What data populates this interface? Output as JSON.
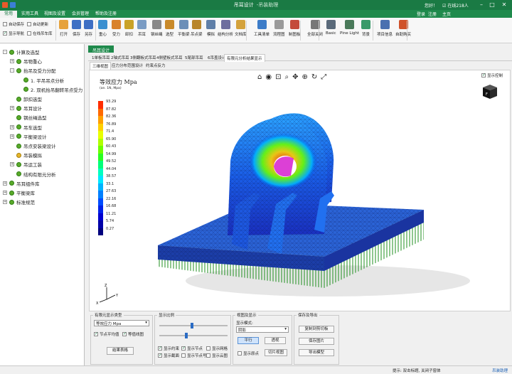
{
  "titlebar": {
    "title": "吊耳设计",
    "subtitle": "-吊装助理",
    "user_text": "您好！",
    "online_text": "在线218人",
    "login": "登录",
    "register": "注册",
    "home": "主页"
  },
  "menu": [
    "常用",
    "实用工具",
    "视图及设置",
    "会员管理",
    "帮助及注册"
  ],
  "ribbon_checks": [
    {
      "label": "自动保存",
      "checked": false
    },
    {
      "label": "自动更新",
      "checked": false
    },
    {
      "label": "显示导航",
      "checked": true
    },
    {
      "label": "在线吊车库",
      "checked": false
    }
  ],
  "ribbon_tools": [
    {
      "label": "打开",
      "color": "#e6a23c"
    },
    {
      "label": "保存",
      "color": "#3d6fc4"
    },
    {
      "label": "另存",
      "color": "#3d6fc4"
    },
    {
      "label": "重心",
      "color": "#3a8fd0"
    },
    {
      "label": "受力",
      "color": "#d9822b"
    },
    {
      "label": "卸扣",
      "color": "#c9a227"
    },
    {
      "label": "吊耳",
      "color": "#7a9cc4"
    },
    {
      "label": "钢丝绳",
      "color": "#888888"
    },
    {
      "label": "选型",
      "color": "#c98a2a"
    },
    {
      "label": "平衡梁",
      "color": "#6c8fb8"
    },
    {
      "label": "吊点梁",
      "color": "#b8862a"
    },
    {
      "label": "模拟",
      "color": "#5f7fa8"
    },
    {
      "label": "结构分析",
      "color": "#6e6e9e"
    },
    {
      "label": "文档库",
      "color": "#d4a23c"
    },
    {
      "label": "工具清单",
      "color": "#3c7cc8"
    },
    {
      "label": "流程图",
      "color": "#9a9a9a"
    },
    {
      "label": "制图板",
      "color": "#c44a3a"
    },
    {
      "label": "全部关闭",
      "color": "#777777"
    },
    {
      "label": "Basic",
      "color": "#5a6a7a"
    },
    {
      "label": "Pine Light",
      "color": "#4a7a5a"
    },
    {
      "label": "背景",
      "color": "#3a9a6a"
    },
    {
      "label": "项目信息",
      "color": "#4a70b0"
    },
    {
      "label": "自助购买",
      "color": "#d0522a"
    }
  ],
  "tree": [
    {
      "label": "计算及选型",
      "level": 0,
      "exp": "-",
      "icon": "leaf"
    },
    {
      "label": "吊物重心",
      "level": 1,
      "exp": "+",
      "icon": "leaf"
    },
    {
      "label": "抬吊及受力分配",
      "level": 1,
      "exp": "-",
      "icon": "leaf"
    },
    {
      "label": "1. 平吊吊点分析",
      "level": 2,
      "exp": "",
      "icon": "leaf"
    },
    {
      "label": "2. 双机抬吊翻转吊点受力",
      "level": 2,
      "exp": "",
      "icon": "leaf"
    },
    {
      "label": "卸扣选型",
      "level": 1,
      "exp": "",
      "icon": "leaf"
    },
    {
      "label": "吊耳设计",
      "level": 1,
      "exp": "+",
      "icon": "leaf"
    },
    {
      "label": "钢丝绳选型",
      "level": 1,
      "exp": "",
      "icon": "leaf"
    },
    {
      "label": "吊车选型",
      "level": 1,
      "exp": "+",
      "icon": "leaf"
    },
    {
      "label": "平衡梁设计",
      "level": 1,
      "exp": "+",
      "icon": "leaf"
    },
    {
      "label": "吊点安装梁设计",
      "level": 1,
      "exp": "",
      "icon": "leaf"
    },
    {
      "label": "吊装模拟",
      "level": 1,
      "exp": "",
      "icon": "yellow"
    },
    {
      "label": "吊运工装",
      "level": 1,
      "exp": "+",
      "icon": "leaf"
    },
    {
      "label": "结构有限元分析",
      "level": 1,
      "exp": "",
      "icon": "leaf"
    },
    {
      "label": "吊耳组件库",
      "level": 0,
      "exp": "+",
      "icon": "leaf"
    },
    {
      "label": "平衡梁库",
      "level": 0,
      "exp": "+",
      "icon": "leaf"
    },
    {
      "label": "标准规范",
      "level": 0,
      "exp": "+",
      "icon": "leaf"
    }
  ],
  "doc_tab": "吊耳设计",
  "sub_tabs": [
    "1单板吊耳",
    "2轴式吊耳",
    "3侧翻板式吊耳",
    "4侧壁板式吊耳",
    "5尾部吊耳",
    "6吊盖设计",
    "有限元分析结果显示"
  ],
  "sub_tabs2": [
    "三维视图",
    "应力分布范围设计",
    "约束点反力"
  ],
  "viewport": {
    "show_control": "显示控制",
    "legend_title": "等效应力  Mpa",
    "legend_sub": "(an. 1N, Mpa)",
    "legend_values": [
      "93.29",
      "87.82",
      "82.36",
      "76.89",
      "71.4",
      "65.90",
      "60.43",
      "54.99",
      "49.52",
      "44.04",
      "38.57",
      "33.1",
      "27.63",
      "22.16",
      "16.68",
      "11.21",
      "5.74",
      "0.27"
    ],
    "legend_colors": [
      "#ff2d00",
      "#ff6a00",
      "#ffa000",
      "#ffd000",
      "#e8ff00",
      "#b0ff00",
      "#6dff00",
      "#2aff22",
      "#00ff7a",
      "#00ffc0",
      "#00e8ff",
      "#00b4ff",
      "#0080ff",
      "#004cff",
      "#0022e8",
      "#0000d0",
      "#0000a8",
      "#00007e"
    ]
  },
  "bottom": {
    "fe_title": "有限元显示类型",
    "fe_select": "等效应力 Mpa",
    "node_avg": "节点平均值",
    "contour": "等值线图",
    "result_table": "结果表格",
    "scale_title": "显示比例",
    "checks": [
      "显示约束",
      "显示节点",
      "显示网格",
      "显示截面",
      "显示节点号",
      "显示云图"
    ],
    "view_title": "视图及显示",
    "display_mode": "显示模式:",
    "mode_value": "阴影",
    "parallel": "平行",
    "transparent": "透视",
    "show_origin": "显示原点",
    "slice_view": "切片视图",
    "save_title": "保存及导出",
    "copy_btn": "复制到剪切板",
    "save_img": "保存图片",
    "export_model": "导出模型"
  },
  "status": {
    "hint": "提示: 双击标题, 关闭子窗体",
    "right": "吊装助理"
  }
}
